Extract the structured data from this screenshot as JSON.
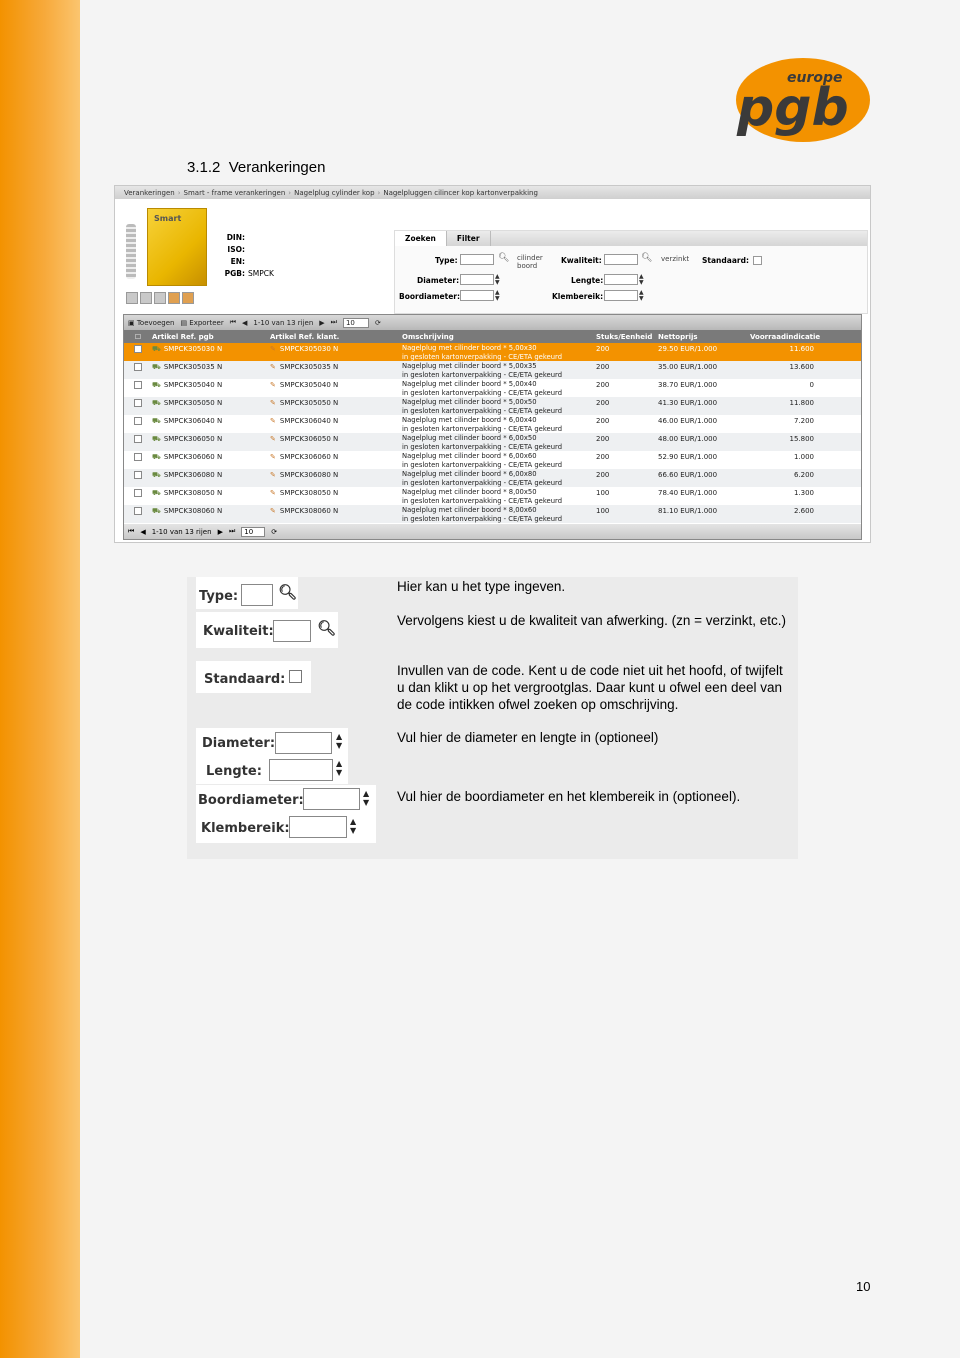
{
  "logo": {
    "word_small": "europe",
    "word_large": "pgb",
    "color": "#f39200"
  },
  "section": {
    "number": "3.1.2",
    "title": "Verankeringen"
  },
  "app": {
    "breadcrumbs": [
      "Verankeringen",
      "Smart - frame verankeringen",
      "Nagelplug cylinder kop",
      "Nagelpluggen cilincer kop kartonverpakking"
    ],
    "product": {
      "brand": "Smart",
      "spec": [
        {
          "label": "DIN:",
          "value": ""
        },
        {
          "label": "ISO:",
          "value": ""
        },
        {
          "label": "EN:",
          "value": ""
        },
        {
          "label": "PGB:",
          "value": "SMPCK"
        }
      ]
    },
    "search": {
      "tabs": [
        "Zoeken",
        "Filter"
      ],
      "type_label": "Type:",
      "type_note": "cilinder boord",
      "kwaliteit_label": "Kwaliteit:",
      "kwaliteit_note": "verzinkt",
      "standaard_label": "Standaard:",
      "diameter_label": "Diameter:",
      "lengte_label": "Lengte:",
      "boordiameter_label": "Boordiameter:",
      "klembereik_label": "Klembereik:"
    },
    "grid": {
      "toolbar": {
        "add": "Toevoegen",
        "export": "Exporteer",
        "range": "1-10 van 13 rijen",
        "page_size": "10"
      },
      "columns": [
        "Artikel Ref. pgb",
        "Artikel Ref. klant.",
        "Omschrijving",
        "Stuks/Eenheid",
        "Nettoprijs",
        "Voorraadindicatie"
      ],
      "rows": [
        {
          "ref": "SMPCK305030 N",
          "klant": "SMPCK305030 N",
          "desc1": "Nagelplug met cilinder boord * 5,00x30",
          "desc2": "in gesloten kartonverpakking - CE/ETA gekeurd",
          "stuks": "200",
          "prijs": "29.50 EUR/1.000",
          "voorraad": "11.600"
        },
        {
          "ref": "SMPCK305035 N",
          "klant": "SMPCK305035 N",
          "desc1": "Nagelplug met cilinder boord * 5,00x35",
          "desc2": "in gesloten kartonverpakking - CE/ETA gekeurd",
          "stuks": "200",
          "prijs": "35.00 EUR/1.000",
          "voorraad": "13.600"
        },
        {
          "ref": "SMPCK305040 N",
          "klant": "SMPCK305040 N",
          "desc1": "Nagelplug met cilinder boord * 5,00x40",
          "desc2": "in gesloten kartonverpakking - CE/ETA gekeurd",
          "stuks": "200",
          "prijs": "38.70 EUR/1.000",
          "voorraad": "0"
        },
        {
          "ref": "SMPCK305050 N",
          "klant": "SMPCK305050 N",
          "desc1": "Nagelplug met cilinder boord * 5,00x50",
          "desc2": "in gesloten kartonverpakking - CE/ETA gekeurd",
          "stuks": "200",
          "prijs": "41.30 EUR/1.000",
          "voorraad": "11.800"
        },
        {
          "ref": "SMPCK306040 N",
          "klant": "SMPCK306040 N",
          "desc1": "Nagelplug met cilinder boord * 6,00x40",
          "desc2": "in gesloten kartonverpakking - CE/ETA gekeurd",
          "stuks": "200",
          "prijs": "46.00 EUR/1.000",
          "voorraad": "7.200"
        },
        {
          "ref": "SMPCK306050 N",
          "klant": "SMPCK306050 N",
          "desc1": "Nagelplug met cilinder boord * 6,00x50",
          "desc2": "in gesloten kartonverpakking - CE/ETA gekeurd",
          "stuks": "200",
          "prijs": "48.00 EUR/1.000",
          "voorraad": "15.800"
        },
        {
          "ref": "SMPCK306060 N",
          "klant": "SMPCK306060 N",
          "desc1": "Nagelplug met cilinder boord * 6,00x60",
          "desc2": "in gesloten kartonverpakking - CE/ETA gekeurd",
          "stuks": "200",
          "prijs": "52.90 EUR/1.000",
          "voorraad": "1.000"
        },
        {
          "ref": "SMPCK306080 N",
          "klant": "SMPCK306080 N",
          "desc1": "Nagelplug met cilinder boord * 6,00x80",
          "desc2": "in gesloten kartonverpakking - CE/ETA gekeurd",
          "stuks": "200",
          "prijs": "66.60 EUR/1.000",
          "voorraad": "6.200"
        },
        {
          "ref": "SMPCK308050 N",
          "klant": "SMPCK308050 N",
          "desc1": "Nagelplug met cilinder boord * 8,00x50",
          "desc2": "in gesloten kartonverpakking - CE/ETA gekeurd",
          "stuks": "100",
          "prijs": "78.40 EUR/1.000",
          "voorraad": "1.300"
        },
        {
          "ref": "SMPCK308060 N",
          "klant": "SMPCK308060 N",
          "desc1": "Nagelplug met cilinder boord * 8,00x60",
          "desc2": "in gesloten kartonverpakking - CE/ETA gekeurd",
          "stuks": "100",
          "prijs": "81.10 EUR/1.000",
          "voorraad": "2.600"
        }
      ],
      "footer": {
        "range": "1-10 van 13 rijen",
        "page_size": "10"
      }
    }
  },
  "explain": {
    "labels": {
      "type": "Type:",
      "kwaliteit": "Kwaliteit:",
      "standaard": "Standaard:",
      "diameter": "Diameter:",
      "lengte": "Lengte:",
      "boordiameter": "Boordiameter:",
      "klembereik": "Klembereik:"
    },
    "text_type": "Hier kan u het type ingeven.",
    "text_kwaliteit": "Vervolgens kiest u de kwaliteit van afwerking. (zn = verzinkt, etc.)",
    "text_standaard": "Invullen van de code. Kent u de code niet uit het hoofd, of twijfelt u dan klikt u op het vergrootglas. Daar kunt u ofwel een deel van de code intikken ofwel zoeken op omschrijving.",
    "text_diameter": "Vul hier de diameter en lengte in (optioneel)",
    "text_boor": "Vul hier de boordiameter en het klembereik in (optioneel)."
  },
  "page_number": "10"
}
